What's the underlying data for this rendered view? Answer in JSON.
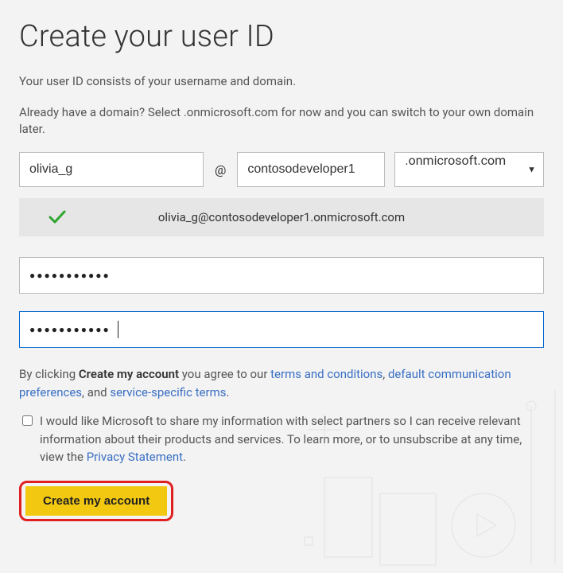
{
  "heading": "Create your user ID",
  "intro1": "Your user ID consists of your username and domain.",
  "intro2": "Already have a domain? Select .onmicrosoft.com for now and you can switch to your own domain later.",
  "username": {
    "value": "olivia_g"
  },
  "at": "@",
  "tenant": {
    "value": "contosodeveloper1"
  },
  "tld": {
    "selected": ".onmicrosoft.com"
  },
  "confirm_email": "olivia_g@contosodeveloper1.onmicrosoft.com",
  "password1": {
    "value": "●●●●●●●●●●●"
  },
  "password2": {
    "value": "●●●●●●●●●●●"
  },
  "terms": {
    "prefix": "By clicking ",
    "action_bold": "Create my account",
    "middle": " you agree to our ",
    "link1": "terms and conditions",
    "sep1": ", ",
    "link2": "default communication preferences",
    "sep2": ", and ",
    "link3": "service-specific terms",
    "end": "."
  },
  "consent": {
    "text_before": "I would like Microsoft to share my information with select partners so I can receive relevant information about their products and services. To learn more, or to unsubscribe at any time, view the ",
    "privacy_link": "Privacy Statement",
    "text_after": "."
  },
  "cta_label": "Create my account"
}
